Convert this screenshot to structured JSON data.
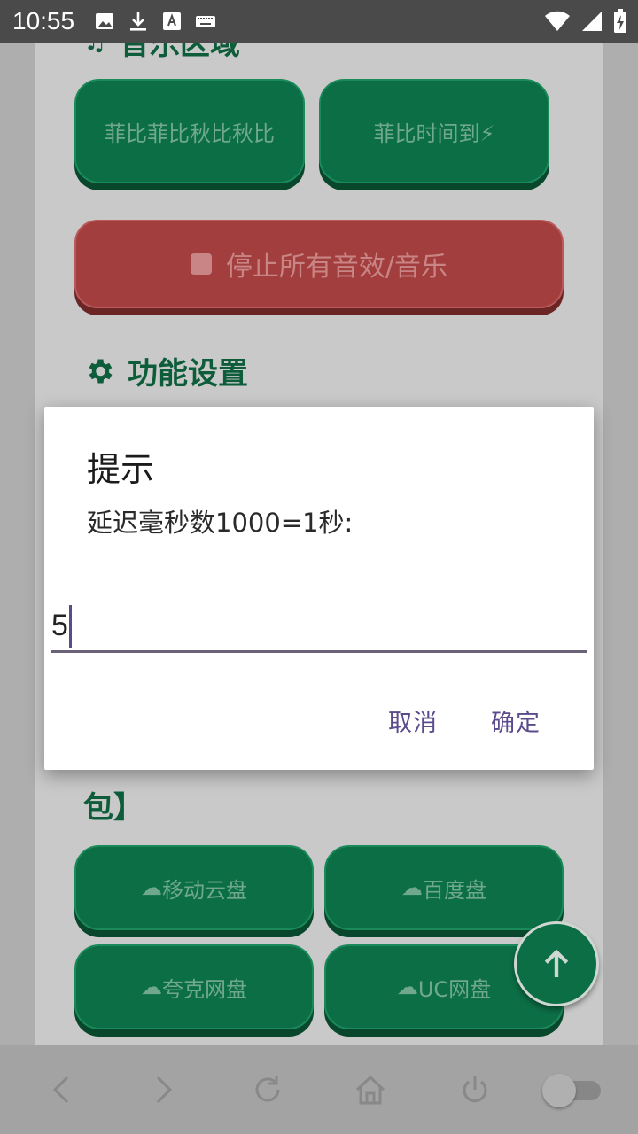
{
  "status_bar": {
    "time": "10:55",
    "left_icons": [
      "image-icon",
      "download-icon",
      "text-a-icon",
      "keyboard-icon"
    ],
    "right_icons": [
      "wifi-icon",
      "cellular-signal-icon",
      "battery-charging-icon"
    ]
  },
  "background_page": {
    "music_section_title": "音乐区域",
    "music_buttons": [
      "菲比菲比秋比秋比",
      "菲比时间到⚡"
    ],
    "stop_button_label": "停止所有音效/音乐",
    "settings_section_title": "功能设置",
    "partial_section_title_line2": "包】",
    "cloud_buttons": [
      "移动云盘",
      "百度盘",
      "夸克网盘",
      "UC网盘"
    ]
  },
  "dialog": {
    "title": "提示",
    "message": "延迟毫秒数1000=1秒:",
    "input_value": "5",
    "cancel_label": "取消",
    "confirm_label": "确定"
  },
  "bottom_nav": {
    "items": [
      "back-icon",
      "forward-icon",
      "refresh-icon",
      "home-icon",
      "power-icon",
      "toggle-switch"
    ]
  },
  "colors": {
    "primary_green": "#0c6e45",
    "stop_red": "#a23e3e",
    "dialog_accent": "#5b4a8c"
  }
}
